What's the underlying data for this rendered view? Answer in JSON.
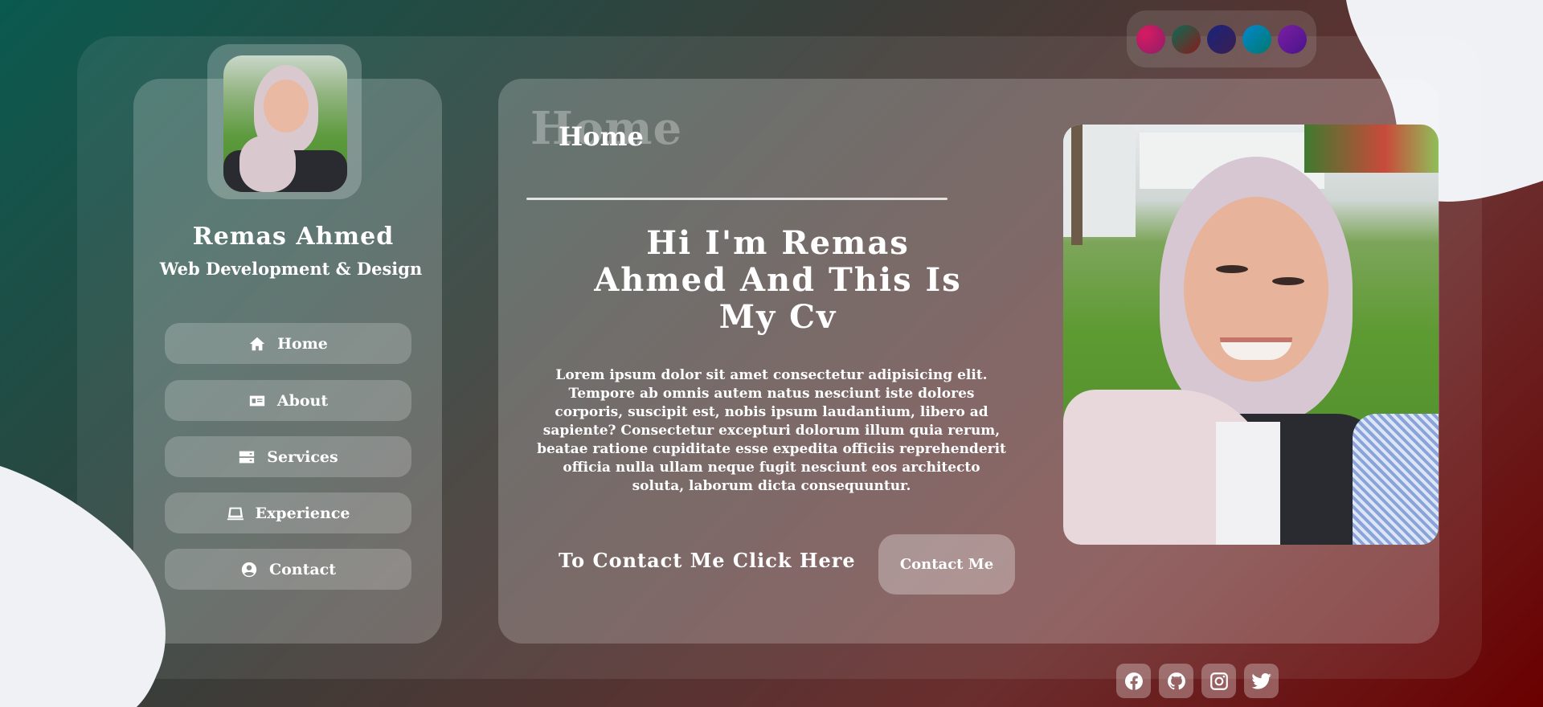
{
  "theme_swatches": [
    {
      "name": "pink-swatch",
      "color": "#c2185b"
    },
    {
      "name": "green-red-swatch",
      "color": "#0a5a4f"
    },
    {
      "name": "navy-swatch",
      "color": "#1a237e"
    },
    {
      "name": "blue-swatch",
      "color": "#0277bd"
    },
    {
      "name": "purple-swatch",
      "color": "#6a1b9a"
    }
  ],
  "profile": {
    "name": "Remas Ahmed",
    "role": "Web Development & Design"
  },
  "nav": {
    "items": [
      {
        "label": "Home",
        "icon": "home-icon"
      },
      {
        "label": "About",
        "icon": "id-card-icon"
      },
      {
        "label": "Services",
        "icon": "server-icon"
      },
      {
        "label": "Experience",
        "icon": "laptop-icon"
      },
      {
        "label": "Contact",
        "icon": "user-circle-icon"
      }
    ]
  },
  "main": {
    "section_ghost": "Home",
    "section_title": "Home",
    "headline_lines": [
      "Hi I'm Remas",
      "Ahmed And This Is",
      "My Cv"
    ],
    "body": "Lorem ipsum dolor sit amet consectetur adipisicing elit. Tempore ab omnis autem natus nesciunt iste dolores corporis, suscipit est, nobis ipsum laudantium, libero ad sapiente? Consectetur excepturi dolorum illum quia rerum, beatae ratione cupiditate esse expedita officiis reprehenderit officia nulla ullam neque fugit nesciunt eos architecto soluta, laborum dicta consequuntur.",
    "contact_prompt": "To Contact Me Click Here",
    "contact_button": "Contact Me"
  },
  "socials": [
    {
      "name": "facebook-icon"
    },
    {
      "name": "github-icon"
    },
    {
      "name": "instagram-icon"
    },
    {
      "name": "twitter-icon"
    }
  ]
}
